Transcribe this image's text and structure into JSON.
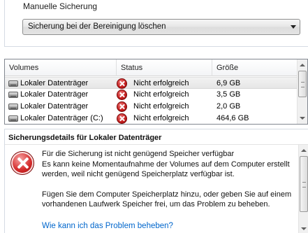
{
  "top": {
    "manual_label": "Manuelle Sicherung",
    "dropdown_value": "Sicherung bei der Bereinigung löschen"
  },
  "list": {
    "columns": [
      "Volumes",
      "Status",
      "Größe"
    ],
    "rows": [
      {
        "volume": "Lokaler Datenträger",
        "status": "Nicht erfolgreich",
        "size": "6,9 GB",
        "selected": true
      },
      {
        "volume": "Lokaler Datenträger",
        "status": "Nicht erfolgreich",
        "size": "3,5 GB",
        "selected": false
      },
      {
        "volume": "Lokaler Datenträger",
        "status": "Nicht erfolgreich",
        "size": "2,0 GB",
        "selected": false
      },
      {
        "volume": "Lokaler Datenträger (C:)",
        "status": "Nicht erfolgreich",
        "size": "464,6 GB",
        "selected": false
      }
    ]
  },
  "details": {
    "heading": "Sicherungsdetails für Lokaler Datenträger",
    "error_title": "Für die Sicherung ist nicht genügend Speicher verfügbar",
    "paragraph1": "Es kann keine Momentaufnahme der Volumes auf dem Computer erstellt werden, weil nicht genügend Speicherplatz verfügbar ist.",
    "paragraph2": "Fügen Sie dem Computer Speicherplatz hinzu, oder geben Sie auf einem vorhandenen Laufwerk Speicher frei, um das Problem zu beheben.",
    "help_link": "Wie kann ich das Problem beheben?"
  },
  "icons": {
    "drive": "drive-icon",
    "error": "error-icon"
  },
  "colors": {
    "error_red": "#c21a1a",
    "link_blue": "#0066cc"
  }
}
